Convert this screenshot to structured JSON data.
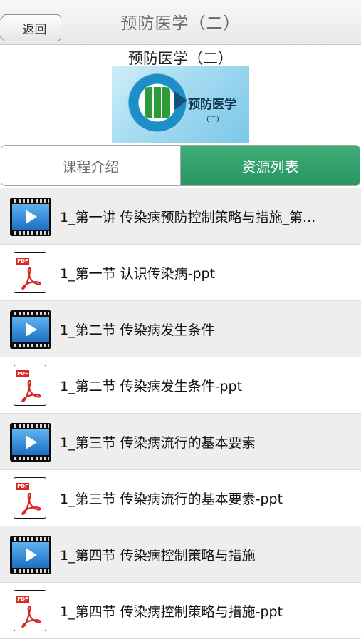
{
  "navbar": {
    "back_label": "返回",
    "title": "预防医学（二）"
  },
  "course": {
    "title": "预防医学（二）",
    "cover_text": "预防医学",
    "cover_sub": "(二)"
  },
  "tabs": [
    {
      "label": "课程介绍",
      "active": false
    },
    {
      "label": "资源列表",
      "active": true
    }
  ],
  "colors": {
    "active_tab": "#2f9e6a",
    "row_alt": "#eeeeee",
    "pdf_red": "#d9271f"
  },
  "resources": [
    {
      "type": "video",
      "icon": "video-icon",
      "title": "1_第一讲 传染病预防控制策略与措施_第..."
    },
    {
      "type": "pdf",
      "icon": "pdf-icon",
      "badge": "PDF",
      "title": "1_第一节 认识传染病-ppt"
    },
    {
      "type": "video",
      "icon": "video-icon",
      "title": "1_第二节 传染病发生条件"
    },
    {
      "type": "pdf",
      "icon": "pdf-icon",
      "badge": "PDF",
      "title": "1_第二节 传染病发生条件-ppt"
    },
    {
      "type": "video",
      "icon": "video-icon",
      "title": "1_第三节 传染病流行的基本要素"
    },
    {
      "type": "pdf",
      "icon": "pdf-icon",
      "badge": "PDF",
      "title": "1_第三节 传染病流行的基本要素-ppt"
    },
    {
      "type": "video",
      "icon": "video-icon",
      "title": "1_第四节 传染病控制策略与措施"
    },
    {
      "type": "pdf",
      "icon": "pdf-icon",
      "badge": "PDF",
      "title": "1_第四节 传染病控制策略与措施-ppt"
    }
  ]
}
